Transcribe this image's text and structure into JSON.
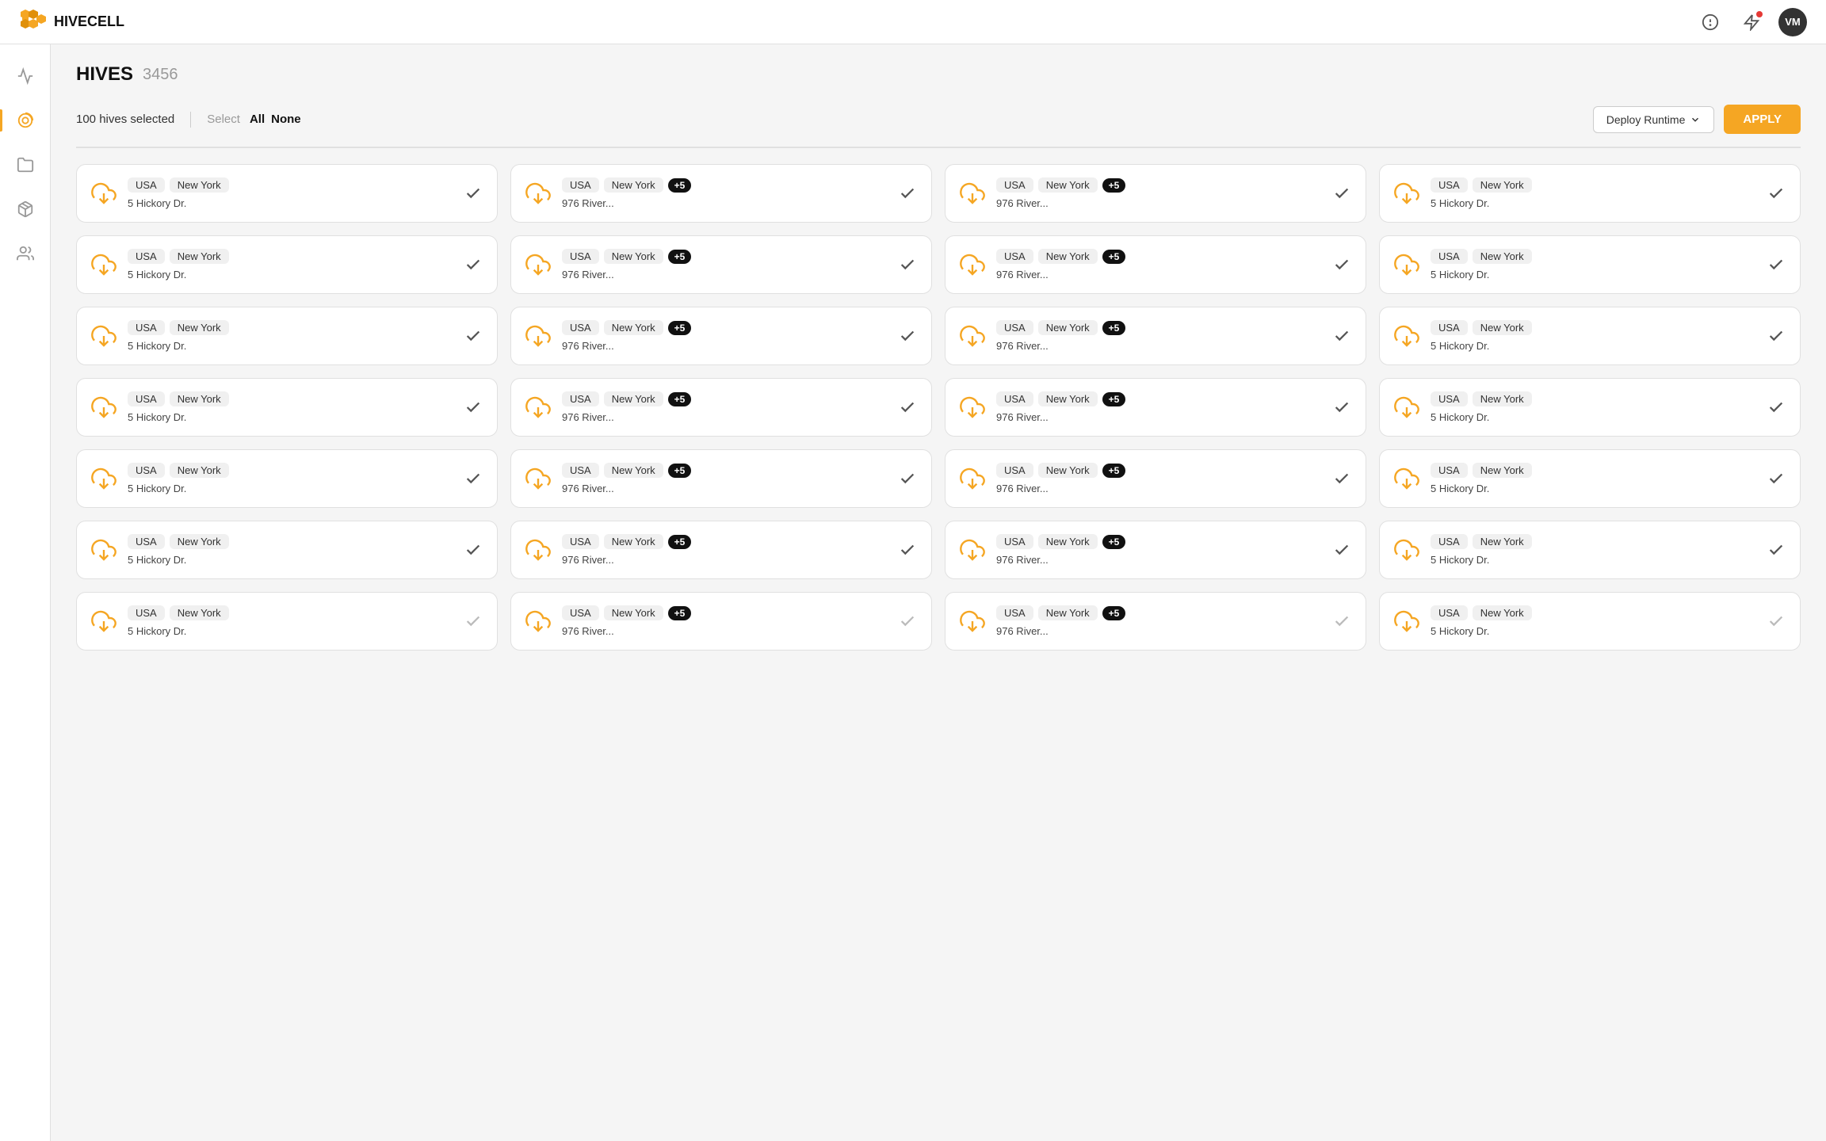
{
  "app": {
    "name": "HIVECELL",
    "avatar": "VM"
  },
  "header": {
    "title": "HIVES",
    "count": "3456"
  },
  "toolbar": {
    "selected_info": "100 hives selected",
    "separator": "|",
    "select_label": "Select",
    "select_all": "All",
    "select_none": "None",
    "deploy_label": "Deploy Runtime",
    "apply_label": "APPLY"
  },
  "sidebar": {
    "items": [
      {
        "name": "activity",
        "label": "Activity",
        "active": false
      },
      {
        "name": "hives",
        "label": "Hives",
        "active": true
      },
      {
        "name": "files",
        "label": "Files",
        "active": false
      },
      {
        "name": "packages",
        "label": "Packages",
        "active": false
      },
      {
        "name": "users",
        "label": "Users",
        "active": false
      }
    ]
  },
  "cards": [
    {
      "type": "simple",
      "country": "USA",
      "city": "New York",
      "address": "5 Hickory Dr.",
      "checked": true
    },
    {
      "type": "multi",
      "country": "USA",
      "city": "New York",
      "address": "976 River...",
      "extra": "+5",
      "checked": true
    },
    {
      "type": "multi",
      "country": "USA",
      "city": "New York",
      "address": "976 River...",
      "extra": "+5",
      "checked": true
    },
    {
      "type": "simple",
      "country": "USA",
      "city": "New York",
      "address": "5 Hickory Dr.",
      "checked": true
    },
    {
      "type": "simple",
      "country": "USA",
      "city": "New York",
      "address": "5 Hickory Dr.",
      "checked": true
    },
    {
      "type": "multi",
      "country": "USA",
      "city": "New York",
      "address": "976 River...",
      "extra": "+5",
      "checked": true
    },
    {
      "type": "multi",
      "country": "USA",
      "city": "New York",
      "address": "976 River...",
      "extra": "+5",
      "checked": true
    },
    {
      "type": "simple",
      "country": "USA",
      "city": "New York",
      "address": "5 Hickory Dr.",
      "checked": true
    },
    {
      "type": "simple",
      "country": "USA",
      "city": "New York",
      "address": "5 Hickory Dr.",
      "checked": true
    },
    {
      "type": "multi",
      "country": "USA",
      "city": "New York",
      "address": "976 River...",
      "extra": "+5",
      "checked": true
    },
    {
      "type": "multi",
      "country": "USA",
      "city": "New York",
      "address": "976 River...",
      "extra": "+5",
      "checked": true
    },
    {
      "type": "simple",
      "country": "USA",
      "city": "New York",
      "address": "5 Hickory Dr.",
      "checked": true
    },
    {
      "type": "simple",
      "country": "USA",
      "city": "New York",
      "address": "5 Hickory Dr.",
      "checked": true
    },
    {
      "type": "multi",
      "country": "USA",
      "city": "New York",
      "address": "976 River...",
      "extra": "+5",
      "checked": true
    },
    {
      "type": "multi",
      "country": "USA",
      "city": "New York",
      "address": "976 River...",
      "extra": "+5",
      "checked": true
    },
    {
      "type": "simple",
      "country": "USA",
      "city": "New York",
      "address": "5 Hickory Dr.",
      "checked": true
    },
    {
      "type": "simple",
      "country": "USA",
      "city": "New York",
      "address": "5 Hickory Dr.",
      "checked": true
    },
    {
      "type": "multi",
      "country": "USA",
      "city": "New York",
      "address": "976 River...",
      "extra": "+5",
      "checked": true
    },
    {
      "type": "multi",
      "country": "USA",
      "city": "New York",
      "address": "976 River...",
      "extra": "+5",
      "checked": true
    },
    {
      "type": "simple",
      "country": "USA",
      "city": "New York",
      "address": "5 Hickory Dr.",
      "checked": true
    },
    {
      "type": "simple",
      "country": "USA",
      "city": "New York",
      "address": "5 Hickory Dr.",
      "checked": true
    },
    {
      "type": "multi",
      "country": "USA",
      "city": "New York",
      "address": "976 River...",
      "extra": "+5",
      "checked": true
    },
    {
      "type": "multi",
      "country": "USA",
      "city": "New York",
      "address": "976 River...",
      "extra": "+5",
      "checked": true
    },
    {
      "type": "simple",
      "country": "USA",
      "city": "New York",
      "address": "5 Hickory Dr.",
      "checked": true
    },
    {
      "type": "simple",
      "country": "USA",
      "city": "New York",
      "address": "5 Hickory Dr.",
      "checked": false
    },
    {
      "type": "multi",
      "country": "USA",
      "city": "New York",
      "address": "976 River...",
      "extra": "+5",
      "checked": false
    },
    {
      "type": "multi",
      "country": "USA",
      "city": "New York",
      "address": "976 River...",
      "extra": "+5",
      "checked": false
    },
    {
      "type": "simple",
      "country": "USA",
      "city": "New York",
      "address": "5 Hickory Dr.",
      "checked": false
    }
  ]
}
